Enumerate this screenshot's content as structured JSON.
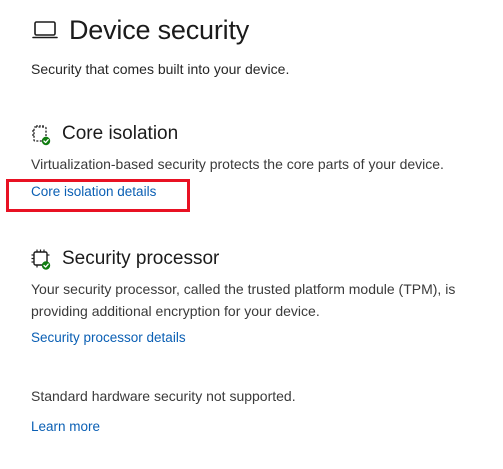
{
  "header": {
    "title": "Device security",
    "subtitle": "Security that comes built into your device.",
    "icon": "laptop-icon"
  },
  "core_isolation": {
    "title": "Core isolation",
    "icon": "core-isolation-chip-check-icon",
    "description": "Virtualization-based security protects the core parts of your device.",
    "link_label": "Core isolation details"
  },
  "security_processor": {
    "title": "Security processor",
    "icon": "security-processor-chip-check-icon",
    "description": "Your security processor, called the trusted platform module (TPM), is providing additional encryption for your device.",
    "link_label": "Security processor details"
  },
  "hardware_status": {
    "text": "Standard hardware security not supported.",
    "link_label": "Learn more"
  },
  "colors": {
    "link": "#0a5fb4",
    "check_badge": "#107c10",
    "highlight": "#e81123"
  }
}
